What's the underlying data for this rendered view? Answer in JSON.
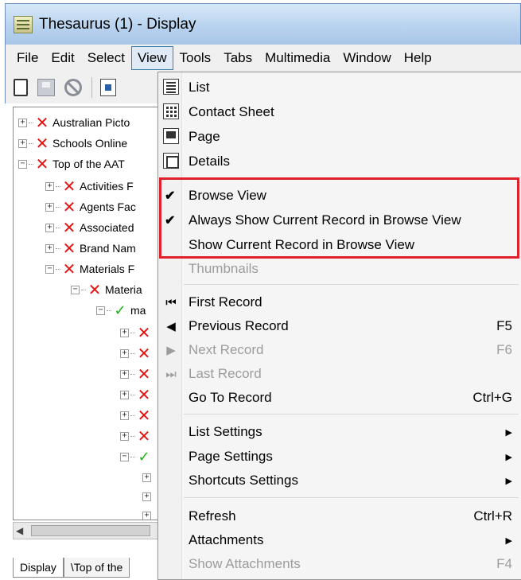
{
  "window": {
    "title": "Thesaurus (1) - Display"
  },
  "menubar": [
    "File",
    "Edit",
    "Select",
    "View",
    "Tools",
    "Tabs",
    "Multimedia",
    "Window",
    "Help"
  ],
  "tree": {
    "items": [
      {
        "label": "Australian Picto",
        "state": "x"
      },
      {
        "label": "Schools Online",
        "state": "x"
      },
      {
        "label": "Top of the AAT",
        "state": "x"
      },
      {
        "label": "Activities F",
        "state": "x"
      },
      {
        "label": "Agents Fac",
        "state": "x"
      },
      {
        "label": "Associated",
        "state": "x"
      },
      {
        "label": "Brand Nam",
        "state": "x"
      },
      {
        "label": "Materials F",
        "state": "x"
      },
      {
        "label": "Materia",
        "state": "x"
      },
      {
        "label": "ma",
        "state": "check"
      }
    ]
  },
  "tabs": [
    "Display",
    "\\Top of the"
  ],
  "view_menu": {
    "items": [
      {
        "label": "List",
        "icon": "list-view-icon"
      },
      {
        "label": "Contact Sheet",
        "icon": "contact-sheet-icon"
      },
      {
        "label": "Page",
        "icon": "page-view-icon"
      },
      {
        "label": "Details",
        "icon": "details-view-icon"
      },
      {
        "label": "Browse View",
        "checked": true
      },
      {
        "label": "Always Show Current Record in Browse View",
        "checked": true
      },
      {
        "label": "Show Current Record in Browse View"
      },
      {
        "label": "Thumbnails",
        "disabled": true
      },
      {
        "label": "First Record",
        "icon": "first-record-icon"
      },
      {
        "label": "Previous Record",
        "icon": "previous-record-icon",
        "shortcut": "F5"
      },
      {
        "label": "Next Record",
        "icon": "next-record-icon",
        "shortcut": "F6",
        "disabled": true
      },
      {
        "label": "Last Record",
        "icon": "last-record-icon",
        "disabled": true
      },
      {
        "label": "Go To Record",
        "shortcut": "Ctrl+G"
      },
      {
        "label": "List Settings",
        "submenu": true
      },
      {
        "label": "Page Settings",
        "submenu": true
      },
      {
        "label": "Shortcuts Settings",
        "submenu": true
      },
      {
        "label": "Refresh",
        "shortcut": "Ctrl+R"
      },
      {
        "label": "Attachments",
        "submenu": true
      },
      {
        "label": "Show Attachments",
        "shortcut": "F4",
        "disabled": true
      }
    ]
  },
  "colors": {
    "highlight_border": "#e0202a",
    "error_x": "#e01414",
    "ok_check": "#15b515"
  }
}
